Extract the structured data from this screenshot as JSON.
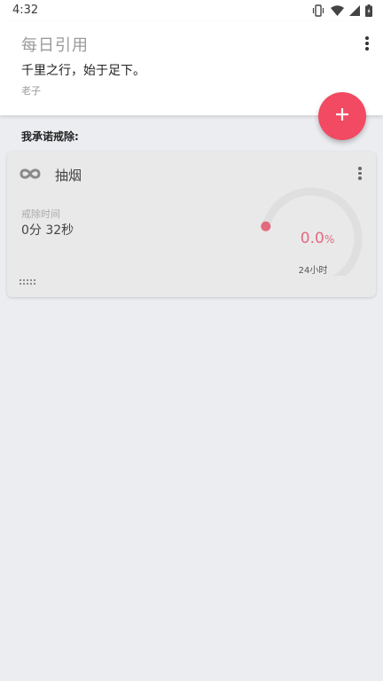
{
  "status_bar": {
    "time": "4:32"
  },
  "quote": {
    "title": "每日引用",
    "text": "千里之行，始于足下。",
    "author": "老子"
  },
  "section": {
    "label": "我承诺戒除:"
  },
  "habit": {
    "name": "抽烟",
    "elapsed_label": "戒除时间",
    "elapsed_value": "0分 32秒",
    "progress_value": "0.0",
    "progress_unit": "%",
    "progress_fraction": 0.0,
    "goal_label": "24小时"
  },
  "colors": {
    "accent": "#f14a62",
    "gauge_track": "#dfdfdf",
    "gauge_marker": "#e26a7e"
  }
}
